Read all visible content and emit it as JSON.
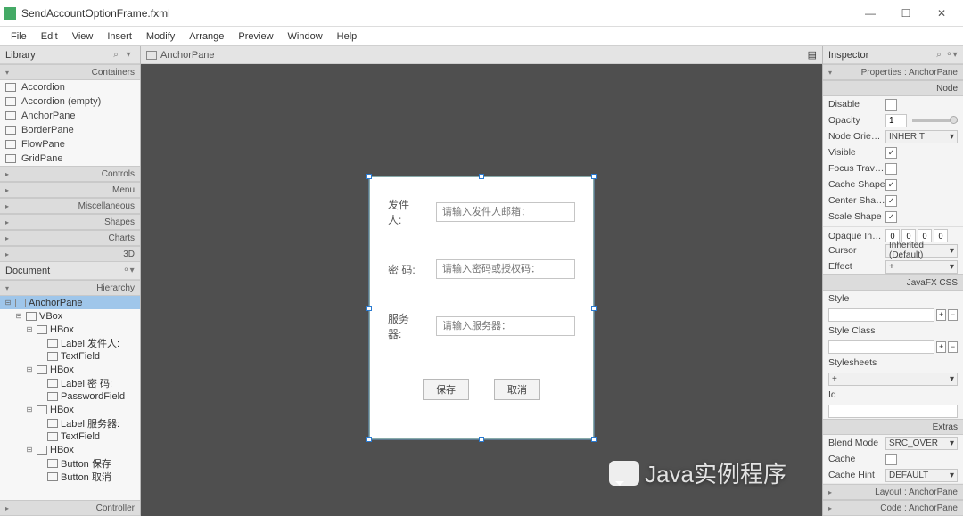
{
  "window": {
    "title": "SendAccountOptionFrame.fxml"
  },
  "menubar": [
    "File",
    "Edit",
    "View",
    "Insert",
    "Modify",
    "Arrange",
    "Preview",
    "Window",
    "Help"
  ],
  "library": {
    "title": "Library",
    "sections": {
      "containers": "Containers",
      "controls": "Controls",
      "menu": "Menu",
      "misc": "Miscellaneous",
      "shapes": "Shapes",
      "charts": "Charts",
      "three_d": "3D"
    },
    "container_items": [
      "Accordion",
      "Accordion  (empty)",
      "AnchorPane",
      "BorderPane",
      "FlowPane",
      "GridPane"
    ]
  },
  "document": {
    "title": "Document",
    "hierarchy": "Hierarchy",
    "controller": "Controller",
    "tree": [
      {
        "depth": 0,
        "label": "AnchorPane",
        "selected": true,
        "exp": "⊟"
      },
      {
        "depth": 1,
        "label": "VBox",
        "exp": "⊟"
      },
      {
        "depth": 2,
        "label": "HBox",
        "exp": "⊟"
      },
      {
        "depth": 3,
        "label": "Label 发件人:",
        "exp": ""
      },
      {
        "depth": 3,
        "label": "TextField",
        "exp": ""
      },
      {
        "depth": 2,
        "label": "HBox",
        "exp": "⊟"
      },
      {
        "depth": 3,
        "label": "Label 密   码:",
        "exp": ""
      },
      {
        "depth": 3,
        "label": "PasswordField",
        "exp": ""
      },
      {
        "depth": 2,
        "label": "HBox",
        "exp": "⊟"
      },
      {
        "depth": 3,
        "label": "Label 服务器:",
        "exp": ""
      },
      {
        "depth": 3,
        "label": "TextField",
        "exp": ""
      },
      {
        "depth": 2,
        "label": "HBox",
        "exp": "⊟"
      },
      {
        "depth": 3,
        "label": "Button 保存",
        "exp": ""
      },
      {
        "depth": 3,
        "label": "Button 取消",
        "exp": ""
      }
    ]
  },
  "center": {
    "breadcrumb": "AnchorPane"
  },
  "form": {
    "sender_label": "发件人:",
    "sender_ph": "请输入发件人邮箱：",
    "pwd_label": "密   码:",
    "pwd_ph": "请输入密码或授权码：",
    "server_label": "服务器:",
    "server_ph": "请输入服务器：",
    "save": "保存",
    "cancel": "取消"
  },
  "inspector": {
    "title": "Inspector",
    "tab": "Properties : AnchorPane",
    "sections": {
      "node": "Node",
      "javafxcss": "JavaFX CSS",
      "extras": "Extras"
    },
    "disable": "Disable",
    "opacity": "Opacity",
    "opacity_val": "1",
    "node_orient": "Node Orien…",
    "node_orient_val": "INHERIT",
    "visible": "Visible",
    "focus": "Focus Trav…",
    "cache_shape": "Cache Shape",
    "center_shape": "Center Shape",
    "scale_shape": "Scale Shape",
    "opaque": "Opaque Ins…",
    "opaque_vals": [
      "0",
      "0",
      "0",
      "0"
    ],
    "cursor": "Cursor",
    "cursor_val": "Inherited (Default)",
    "effect": "Effect",
    "effect_val": "+",
    "style": "Style",
    "style_class": "Style Class",
    "stylesheets": "Stylesheets",
    "stylesheets_val": "+",
    "id": "Id",
    "blend": "Blend Mode",
    "blend_val": "SRC_OVER",
    "cache": "Cache",
    "cache_hint": "Cache Hint",
    "cache_hint_val": "DEFAULT",
    "layout_tab": "Layout : AnchorPane",
    "code_tab": "Code : AnchorPane"
  },
  "watermark": "Java实例程序"
}
